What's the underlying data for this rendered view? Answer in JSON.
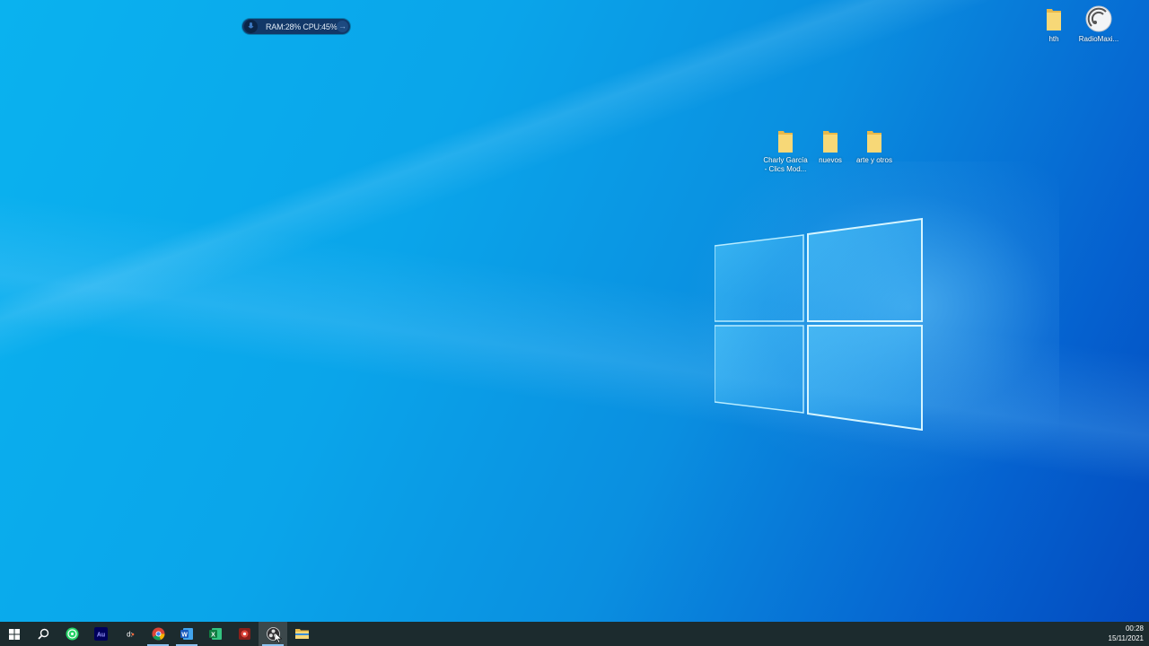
{
  "widget": {
    "text": "RAM:28%  CPU:45%",
    "arrow": "→"
  },
  "desktop_icons": {
    "hth": {
      "label": "hth",
      "icon": "folder-icon"
    },
    "radio": {
      "label": "RadioMaxi...",
      "icon": "radio-app-icon"
    },
    "charly": {
      "label_line1": "Charly García",
      "label_line2": "- Clics Mod...",
      "icon": "folder-icon"
    },
    "nuevos": {
      "label": "nuevos",
      "icon": "folder-icon"
    },
    "arte": {
      "label": "arte y otros",
      "icon": "folder-icon"
    }
  },
  "taskbar": {
    "apps": [
      "start",
      "search",
      "whatsapp",
      "audition",
      "davinci-resolve",
      "chrome",
      "word",
      "excel",
      "media-app",
      "obs",
      "file-explorer"
    ],
    "clock": {
      "time": "00:28",
      "date": "15/11/2021"
    }
  },
  "colors": {
    "accent": "#0a8fe0",
    "taskbar": "#1c2b2e",
    "folder": "#f5d36b"
  }
}
